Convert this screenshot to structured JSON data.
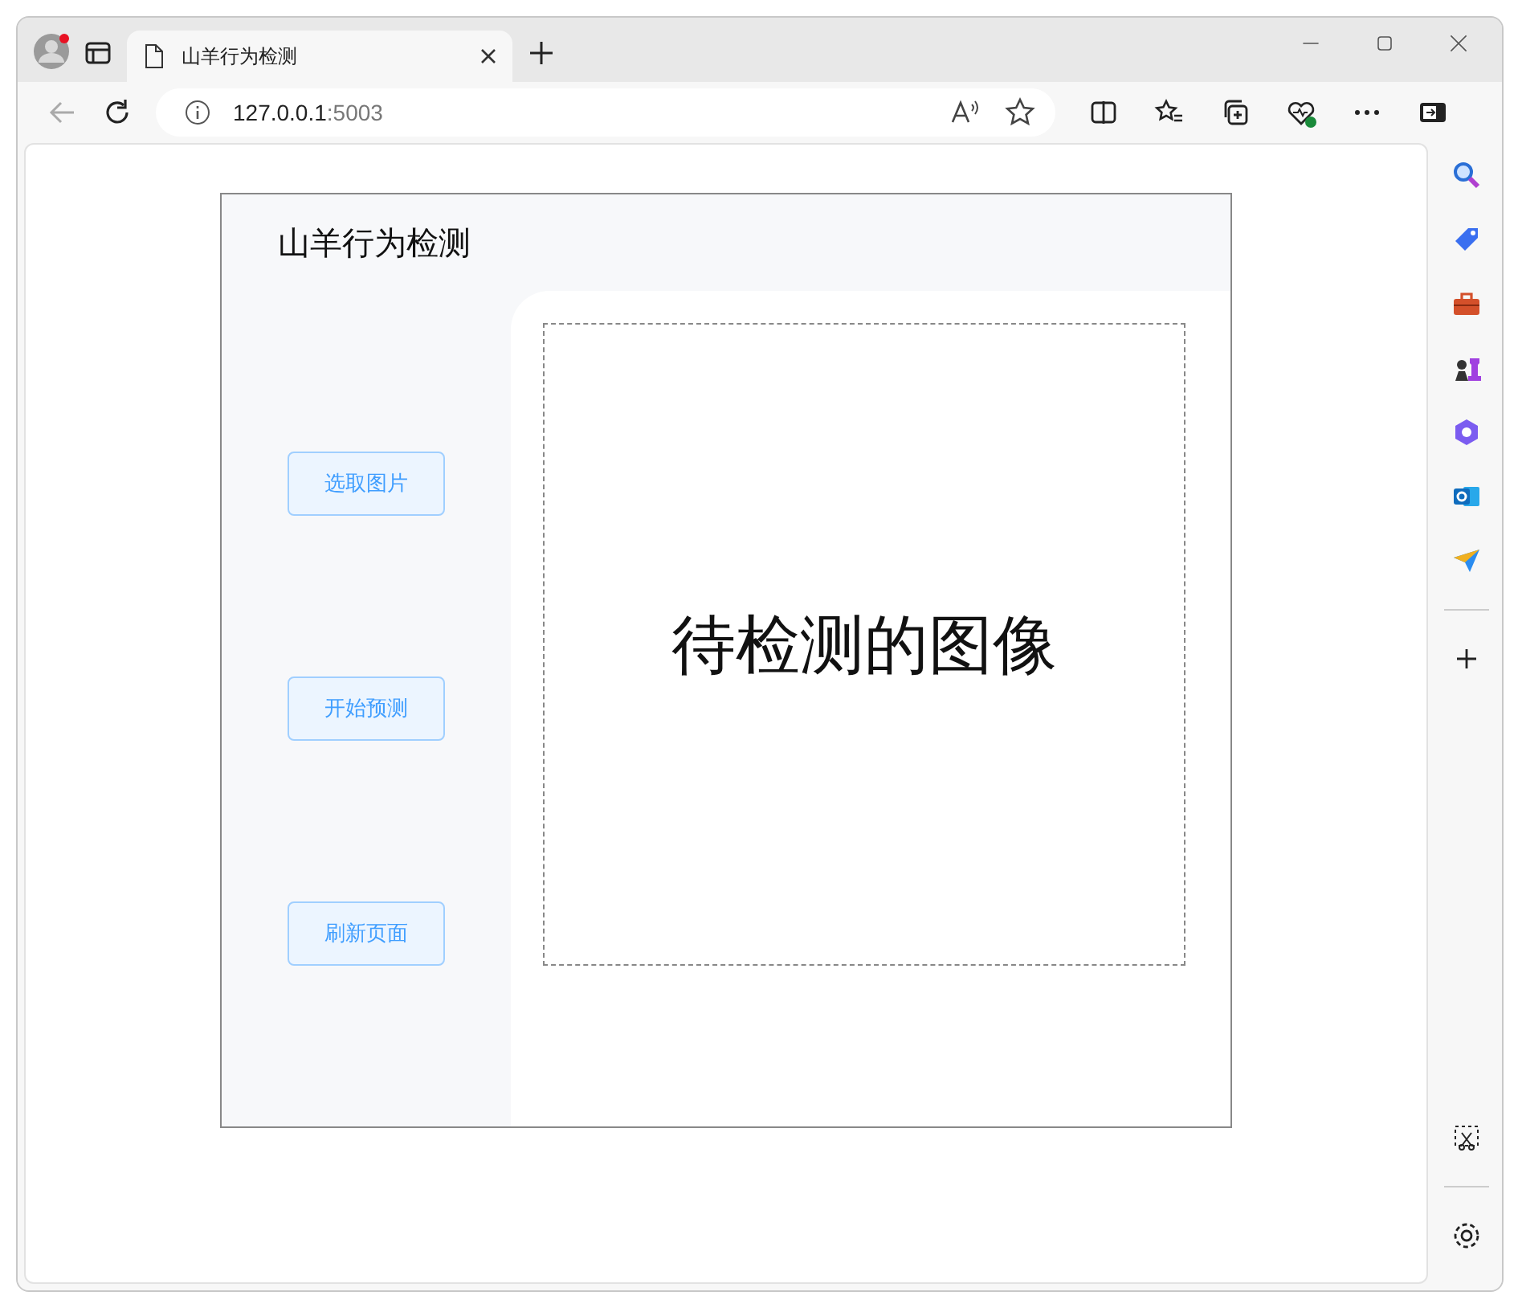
{
  "browser": {
    "tab": {
      "title": "山羊行为检测",
      "selected": true
    },
    "address": {
      "host": "127.0.0.1",
      "port": ":5003"
    }
  },
  "app": {
    "title": "山羊行为检测",
    "buttons": [
      {
        "label": "选取图片"
      },
      {
        "label": "开始预测"
      },
      {
        "label": "刷新页面"
      }
    ],
    "preview": {
      "caption": "待检测的图像"
    }
  }
}
